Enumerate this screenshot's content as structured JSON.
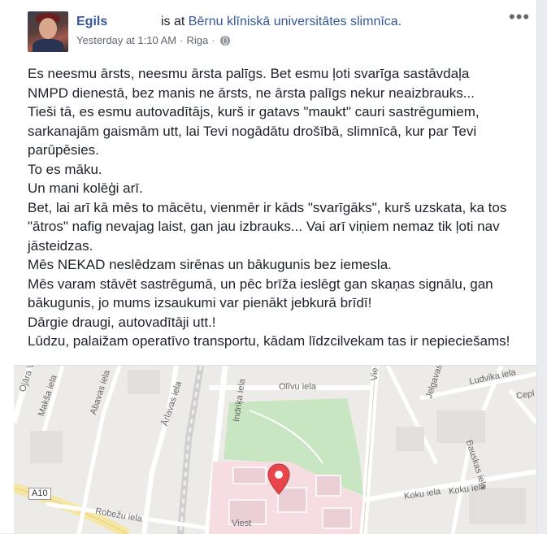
{
  "post": {
    "author": "Egils",
    "action_prefix": "is at",
    "place": "Bērnu klīniskā universitātes slimnīca.",
    "timestamp": "Yesterday at 1:10 AM",
    "location": "Riga",
    "separator": "·",
    "more_icon": "more-horizontal-icon",
    "privacy_icon": "globe-icon",
    "lines": [
      "Es neesmu ārsts, neesmu ārsta palīgs. Bet esmu ļoti svarīga sastāvdaļa",
      "NMPD dienestā, bez manis ne ārsts, ne ārsta palīgs nekur neaizbrauks...",
      "Tieši tā, es esmu autovadītājs, kurš ir gatavs \"maukt\" cauri sastrēgumiem,",
      "sarkanajām gaismām utt, lai Tevi nogādātu drošībā, slimnīcā, kur par Tevi",
      "parūpēsies.",
      "To es māku.",
      "Un mani kolēģi arī.",
      "Bet, lai arī kā mēs to mācētu, vienmēr ir kāds \"svarīgāks\", kurš uzskata, ka tos",
      "\"ātros\" nafig nevajag laist, gan jau izbrauks... Vai arī viņiem nemaz tik ļoti nav",
      "jāsteidzas.",
      "Mēs NEKAD neslēdzam sirēnas un bākugunis bez iemesla.",
      "Mēs varam stāvēt sastrēgumā, un pēc brīža ieslēgt gan skaņas signālu, gan",
      "bākugunis, jo mums izsaukumi var pienākt jebkurā brīdī!",
      "Dārgie draugi, autovadītāji utt.!",
      "Lūdzu, palaižam operatīvo transportu, kādam līdzcilvekam tas ir nepieciešams!"
    ]
  },
  "map": {
    "road_badge": "A10",
    "streets": {
      "ojara": "Ojāra Vācieša iela",
      "maksa": "Makša iela",
      "abava": "Abavas iela",
      "arlavas": "Ārlavas iela",
      "indrika": "Indriķa iela",
      "olivu": "Olīvu iela",
      "viestura": "Vie",
      "jelgavas": "Jelgavas iela",
      "ludvika": "Ludvika iela",
      "cepla": "Cepl",
      "bauskas": "Bauskas iela",
      "koku1": "Koku iela",
      "koku2": "Koku iela",
      "robezu": "Robežu iela",
      "viesturi": "Viest"
    },
    "pin_color": "#e8464a",
    "park_color": "#c8e6c1",
    "hospital_color": "#f5dde2"
  }
}
